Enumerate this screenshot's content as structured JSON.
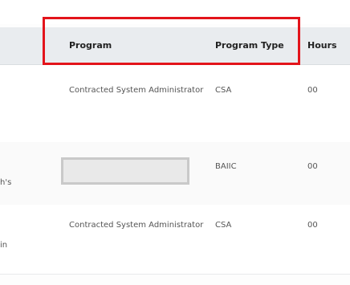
{
  "table": {
    "columns": {
      "program": "Program",
      "program_type": "Program Type",
      "hours": "Hours"
    },
    "rows": [
      {
        "leading": "",
        "program": "Contracted System Administrator",
        "program_type": "CSA",
        "hours": "00"
      },
      {
        "leading": "h's",
        "program": "",
        "program_type": "BAIIC",
        "hours": "00"
      },
      {
        "leading": "in",
        "program": "Contracted System Administrator",
        "program_type": "CSA",
        "hours": "00"
      }
    ]
  },
  "highlight_color": "#e3141b"
}
